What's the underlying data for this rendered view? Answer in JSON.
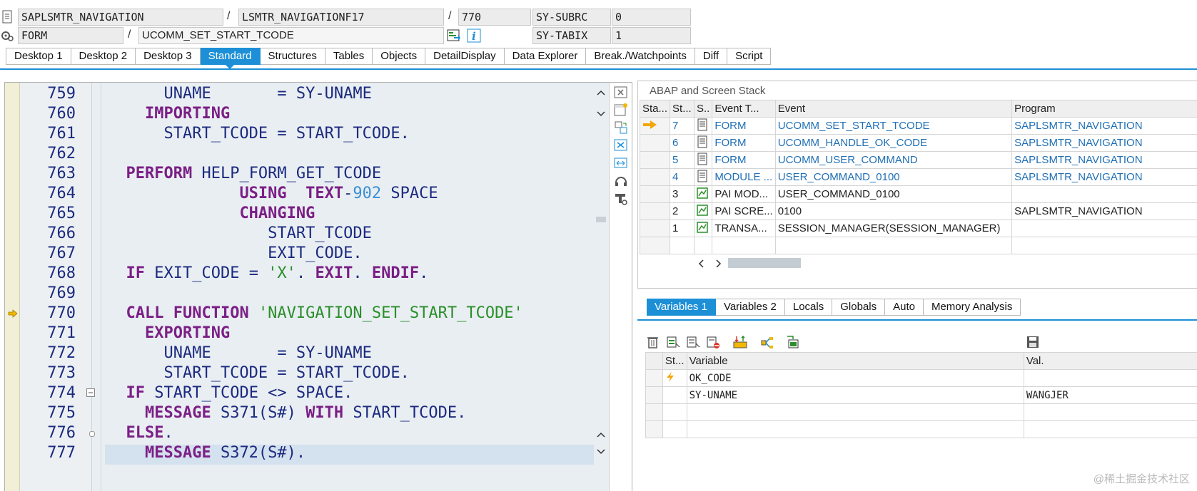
{
  "header": {
    "program": "SAPLSMTR_NAVIGATION",
    "include": "LSMTR_NAVIGATIONF17",
    "line": "770",
    "sy_subrc_label": "SY-SUBRC",
    "sy_subrc_value": "0",
    "event_type": "FORM",
    "event_name": "UCOMM_SET_START_TCODE",
    "sy_tabix_label": "SY-TABIX",
    "sy_tabix_value": "1",
    "sep": "/"
  },
  "tabs": [
    "Desktop 1",
    "Desktop 2",
    "Desktop 3",
    "Standard",
    "Structures",
    "Tables",
    "Objects",
    "DetailDisplay",
    "Data Explorer",
    "Break./Watchpoints",
    "Diff",
    "Script"
  ],
  "code": {
    "lines": [
      {
        "no": "759",
        "html": "      UNAME       = SY-UNAME"
      },
      {
        "no": "760",
        "html": "    <span class=\"kw\">IMPORTING</span>"
      },
      {
        "no": "761",
        "html": "      START_TCODE = START_TCODE."
      },
      {
        "no": "762",
        "html": ""
      },
      {
        "no": "763",
        "html": "  <span class=\"kw\">PERFORM</span> HELP_FORM_GET_TCODE"
      },
      {
        "no": "764",
        "html": "              <span class=\"kw\">USING</span>  <span class=\"kw\">TEXT</span>-<span class=\"num\">902</span> SPACE"
      },
      {
        "no": "765",
        "html": "              <span class=\"kw\">CHANGING</span>"
      },
      {
        "no": "766",
        "html": "                 START_TCODE"
      },
      {
        "no": "767",
        "html": "                 EXIT_CODE."
      },
      {
        "no": "768",
        "html": "  <span class=\"kw\">IF</span> EXIT_CODE = <span class=\"str\">'X'</span>. <span class=\"kw\">EXIT</span>. <span class=\"kw\">ENDIF</span>."
      },
      {
        "no": "769",
        "html": ""
      },
      {
        "no": "770",
        "html": "  <span class=\"kw\">CALL FUNCTION</span> <span class=\"str\">'NAVIGATION_SET_START_TCODE'</span>"
      },
      {
        "no": "771",
        "html": "    <span class=\"kw\">EXPORTING</span>"
      },
      {
        "no": "772",
        "html": "      UNAME       = SY-UNAME"
      },
      {
        "no": "773",
        "html": "      START_TCODE = START_TCODE."
      },
      {
        "no": "774",
        "html": "  <span class=\"kw\">IF</span> START_TCODE &lt;&gt; SPACE."
      },
      {
        "no": "775",
        "html": "    <span class=\"kw\">MESSAGE</span> S371(S#) <span class=\"kw\">WITH</span> START_TCODE."
      },
      {
        "no": "776",
        "html": "  <span class=\"kw\">ELSE</span>."
      },
      {
        "no": "777",
        "html": "    <span class=\"kw\">MESSAGE</span> S372(S#)."
      }
    ]
  },
  "stack": {
    "title": "ABAP and Screen Stack",
    "columns": [
      "Sta...",
      "St...",
      "S..",
      "Event T...",
      "Event",
      "Program"
    ],
    "rows": [
      {
        "level": "7",
        "type": "FORM",
        "event": "UCOMM_SET_START_TCODE",
        "program": "SAPLSMTR_NAVIGATION",
        "link": true,
        "current": true,
        "icon": "code-icon"
      },
      {
        "level": "6",
        "type": "FORM",
        "event": "UCOMM_HANDLE_OK_CODE",
        "program": "SAPLSMTR_NAVIGATION",
        "link": true,
        "current": false,
        "icon": "code-icon"
      },
      {
        "level": "5",
        "type": "FORM",
        "event": "UCOMM_USER_COMMAND",
        "program": "SAPLSMTR_NAVIGATION",
        "link": true,
        "current": false,
        "icon": "code-icon"
      },
      {
        "level": "4",
        "type": "MODULE ...",
        "event": "USER_COMMAND_0100",
        "program": "SAPLSMTR_NAVIGATION",
        "link": true,
        "current": false,
        "icon": "code-icon"
      },
      {
        "level": "3",
        "type": "PAI MOD...",
        "event": "USER_COMMAND_0100",
        "program": "",
        "link": false,
        "current": false,
        "icon": "screen-icon"
      },
      {
        "level": "2",
        "type": "PAI SCRE...",
        "event": "0100",
        "program": "SAPLSMTR_NAVIGATION",
        "link": false,
        "current": false,
        "icon": "screen-icon"
      },
      {
        "level": "1",
        "type": "TRANSA...",
        "event": "SESSION_MANAGER(SESSION_MANAGER)",
        "program": "",
        "link": false,
        "current": false,
        "icon": "screen-icon"
      }
    ]
  },
  "var_tabs": [
    "Variables 1",
    "Variables 2",
    "Locals",
    "Globals",
    "Auto",
    "Memory Analysis"
  ],
  "variables": {
    "columns": [
      "St...",
      "Variable",
      "Val."
    ],
    "rows": [
      {
        "variable": "OK_CODE",
        "value": "",
        "icon": "lightning-icon"
      },
      {
        "variable": "SY-UNAME",
        "value": "WANGJER",
        "icon": ""
      },
      {
        "variable": "",
        "value": "",
        "icon": ""
      },
      {
        "variable": "",
        "value": "",
        "icon": ""
      }
    ]
  },
  "watermark": "@稀土掘金技术社区",
  "colors": {
    "accent": "#1c8fd6",
    "keyword": "#7b1f86",
    "string": "#2a8f2a",
    "link": "#1f6fb5",
    "highlight": "#d4e1ee"
  }
}
